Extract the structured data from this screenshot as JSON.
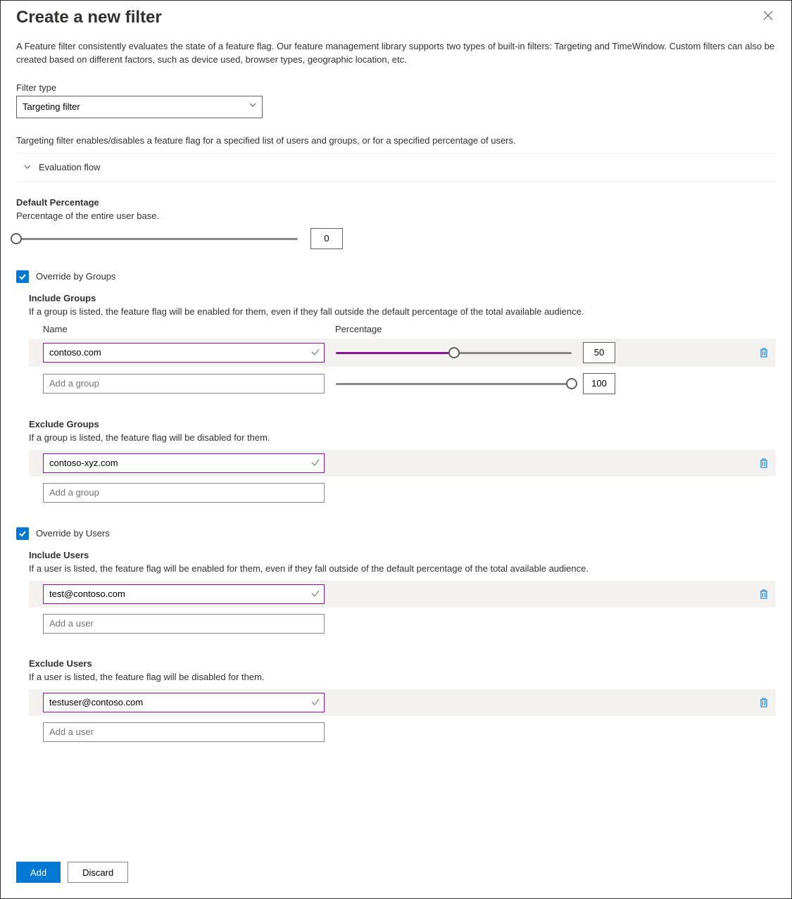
{
  "header": {
    "title": "Create a new filter"
  },
  "intro": "A Feature filter consistently evaluates the state of a feature flag. Our feature management library supports two types of built-in filters: Targeting and TimeWindow. Custom filters can also be created based on different factors, such as device used, browser types, geographic location, etc.",
  "filterType": {
    "label": "Filter type",
    "value": "Targeting filter"
  },
  "targetingDesc": "Targeting filter enables/disables a feature flag for a specified list of users and groups, or for a specified percentage of users.",
  "evalFlow": "Evaluation flow",
  "defaultPct": {
    "title": "Default Percentage",
    "desc": "Percentage of the entire user base.",
    "value": "0"
  },
  "overrideGroups": {
    "label": "Override by Groups",
    "include": {
      "title": "Include Groups",
      "desc": "If a group is listed, the feature flag will be enabled for them, even if they fall outside the default percentage of the total available audience.",
      "colName": "Name",
      "colPct": "Percentage",
      "rows": [
        {
          "name": "contoso.com",
          "pct": "50"
        }
      ],
      "addPlaceholder": "Add a group",
      "addPct": "100"
    },
    "exclude": {
      "title": "Exclude Groups",
      "desc": "If a group is listed, the feature flag will be disabled for them.",
      "rows": [
        {
          "name": "contoso-xyz.com"
        }
      ],
      "addPlaceholder": "Add a group"
    }
  },
  "overrideUsers": {
    "label": "Override by Users",
    "include": {
      "title": "Include Users",
      "desc": "If a user is listed, the feature flag will be enabled for them, even if they fall outside of the default percentage of the total available audience.",
      "rows": [
        {
          "name": "test@contoso.com"
        }
      ],
      "addPlaceholder": "Add a user"
    },
    "exclude": {
      "title": "Exclude Users",
      "desc": "If a user is listed, the feature flag will be disabled for them.",
      "rows": [
        {
          "name": "testuser@contoso.com"
        }
      ],
      "addPlaceholder": "Add a user"
    }
  },
  "footer": {
    "add": "Add",
    "discard": "Discard"
  }
}
